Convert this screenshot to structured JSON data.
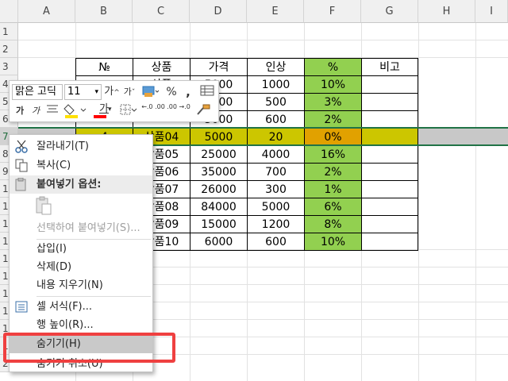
{
  "columns": [
    "A",
    "B",
    "C",
    "D",
    "E",
    "F",
    "G",
    "H",
    "I"
  ],
  "rows": [
    "1",
    "2",
    "3",
    "4",
    "5",
    "6",
    "7",
    "8",
    "9",
    "10",
    "11",
    "12",
    "13",
    "14",
    "15",
    "16",
    "17",
    "18",
    "19",
    "20"
  ],
  "table": {
    "headers": [
      "№",
      "상품",
      "가격",
      "인상",
      "%",
      "비고"
    ],
    "rows": [
      {
        "no": "",
        "product": "상품",
        "price": "5000",
        "raise": "1000",
        "pct": "10%"
      },
      {
        "no": "",
        "product": "",
        "price": "5000",
        "raise": "500",
        "pct": "3%"
      },
      {
        "no": "",
        "product": "",
        "price": "5000",
        "raise": "600",
        "pct": "2%"
      },
      {
        "no": "4",
        "product": "상품04",
        "price": "5000",
        "raise": "20",
        "pct": "0%"
      },
      {
        "no": "",
        "product": "상품05",
        "price": "25000",
        "raise": "4000",
        "pct": "16%"
      },
      {
        "no": "",
        "product": "상품06",
        "price": "35000",
        "raise": "700",
        "pct": "2%"
      },
      {
        "no": "",
        "product": "상품07",
        "price": "26000",
        "raise": "300",
        "pct": "1%"
      },
      {
        "no": "",
        "product": "상품08",
        "price": "84000",
        "raise": "5000",
        "pct": "6%"
      },
      {
        "no": "",
        "product": "상품09",
        "price": "15000",
        "raise": "1200",
        "pct": "8%"
      },
      {
        "no": "",
        "product": "상품10",
        "price": "6000",
        "raise": "600",
        "pct": "10%"
      }
    ]
  },
  "mini_toolbar": {
    "font_name": "맑은 고딕",
    "font_size": "11",
    "grow_font": "가",
    "shrink_font": "가",
    "percent": "%",
    "comma": ",",
    "bold": "가",
    "italic": "가",
    "font_color_glyph": "가",
    "inc_decimal": "←.0 .00",
    "dec_decimal": ".00 →.0"
  },
  "context_menu": {
    "cut": "잘라내기(T)",
    "copy": "복사(C)",
    "paste_options": "붙여넣기 옵션:",
    "paste_special": "선택하여 붙여넣기(S)...",
    "insert": "삽입(I)",
    "delete": "삭제(D)",
    "clear_contents": "내용 지우기(N)",
    "format_cells": "셀 서식(F)...",
    "row_height": "행 높이(R)...",
    "hide": "숨기기(H)",
    "unhide": "숨기기 취소(U)"
  },
  "colors": {
    "selection_border": "#217346",
    "pct_fill": "#92d050",
    "row7_fill": "#ccc600",
    "row7_pct_fill": "#e1a100",
    "callout": "#ef4040"
  }
}
